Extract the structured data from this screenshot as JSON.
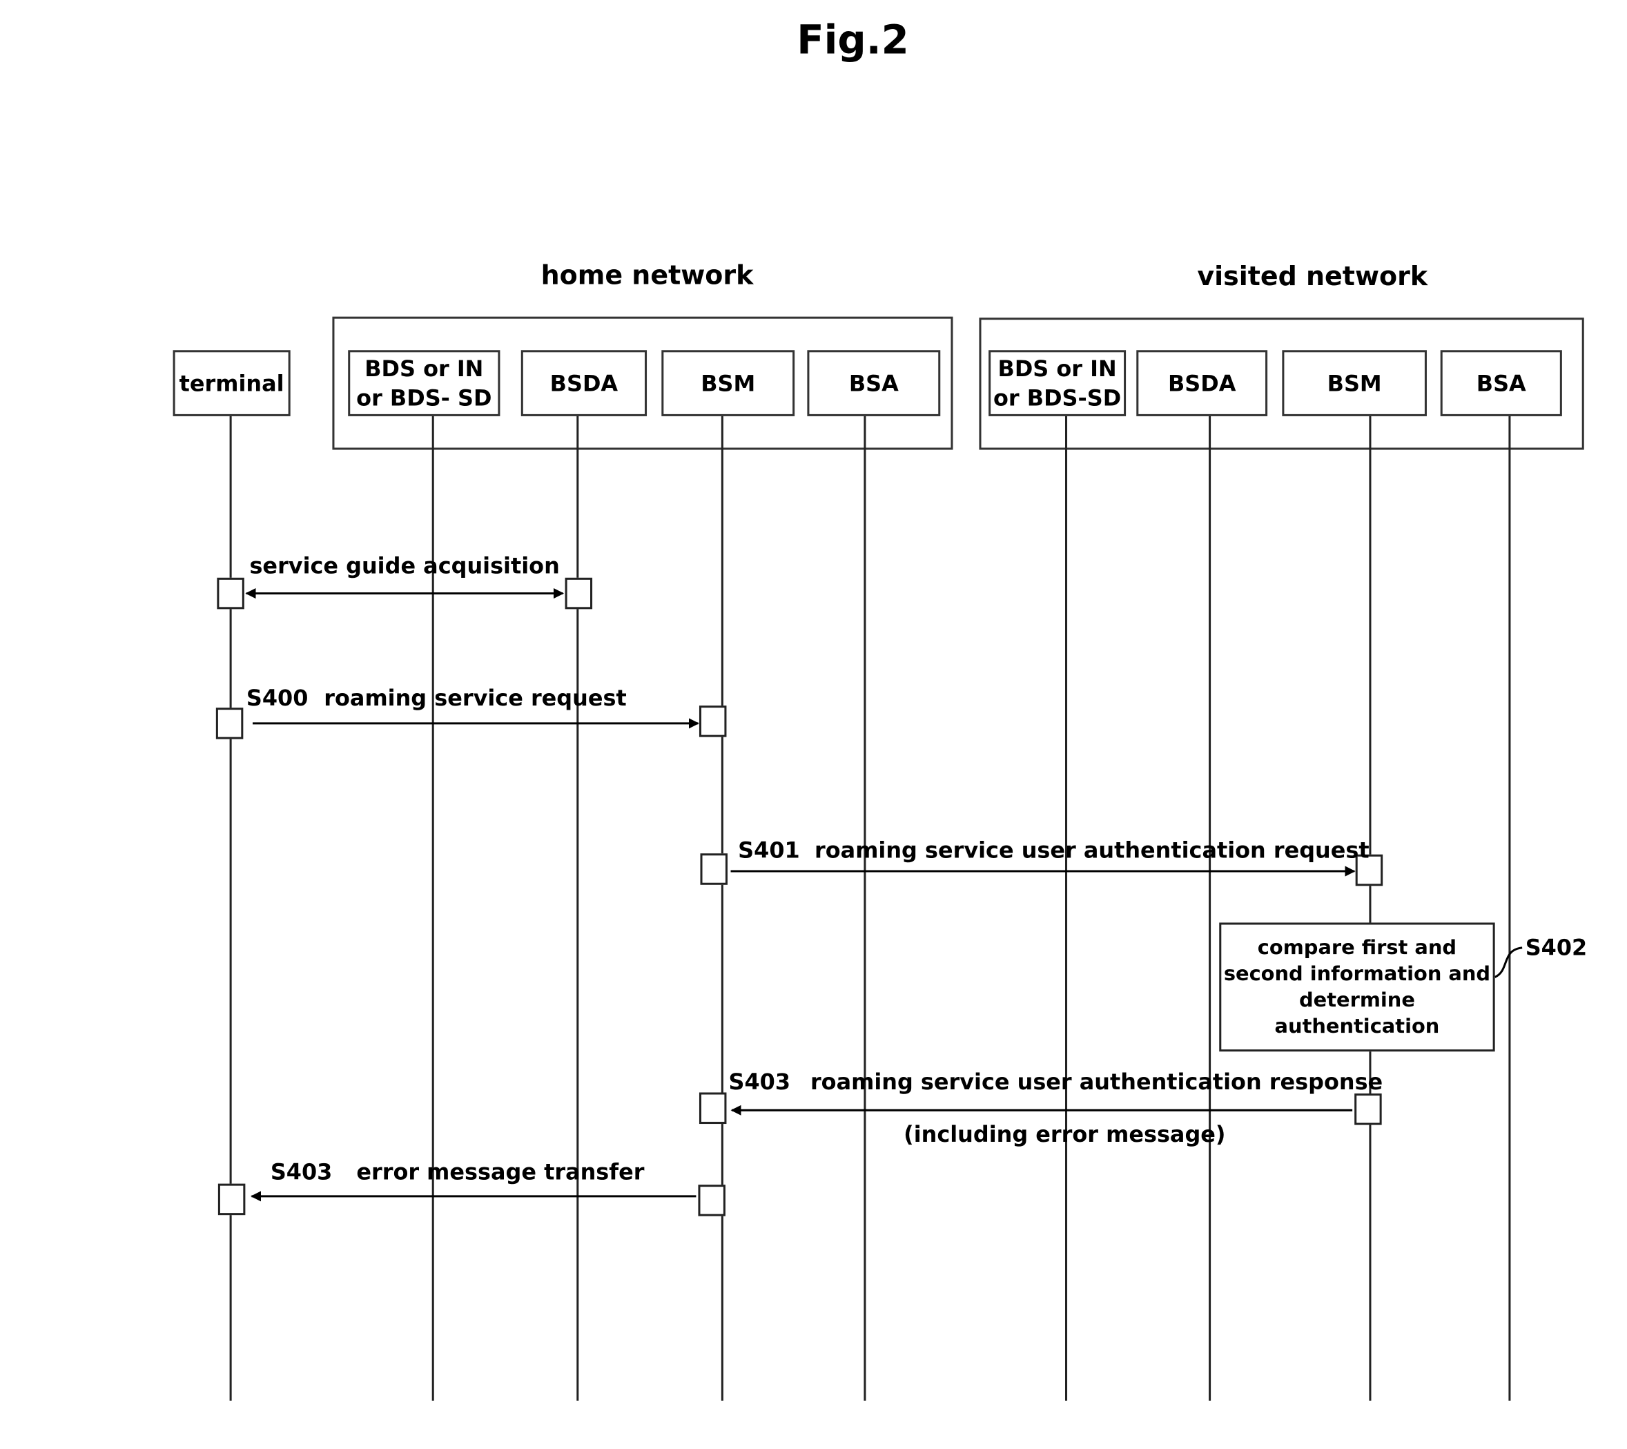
{
  "figure": {
    "title": "Fig.2"
  },
  "groups": {
    "home": "home network",
    "visited": "visited network"
  },
  "entities": {
    "terminal": "terminal",
    "home_bds": [
      "BDS or IN",
      "or BDS- SD"
    ],
    "home_bsda": "BSDA",
    "home_bsm": "BSM",
    "home_bsa": "BSA",
    "visited_bds": [
      "BDS or IN",
      "or BDS-SD"
    ],
    "visited_bsda": "BSDA",
    "visited_bsm": "BSM",
    "visited_bsa": "BSA"
  },
  "messages": [
    {
      "step": "",
      "label": "service guide acquisition",
      "from": "terminal",
      "to": "home BSDA",
      "direction": "bidirectional"
    },
    {
      "step": "S400",
      "label": "roaming service request",
      "from": "terminal",
      "to": "home BSM",
      "direction": "forward"
    },
    {
      "step": "S401",
      "label": "roaming service user authentication request",
      "from": "home BSM",
      "to": "visited BSM",
      "direction": "forward"
    },
    {
      "step": "S403",
      "label": "roaming service user authentication response",
      "sublabel": "(including error message)",
      "from": "visited BSM",
      "to": "home BSM",
      "direction": "backward"
    },
    {
      "step": "S403",
      "label": "error message transfer",
      "from": "home BSM",
      "to": "terminal",
      "direction": "backward"
    }
  ],
  "process": {
    "step": "S402",
    "lines": [
      "compare first and",
      "second information and",
      "determine",
      "authentication"
    ]
  }
}
